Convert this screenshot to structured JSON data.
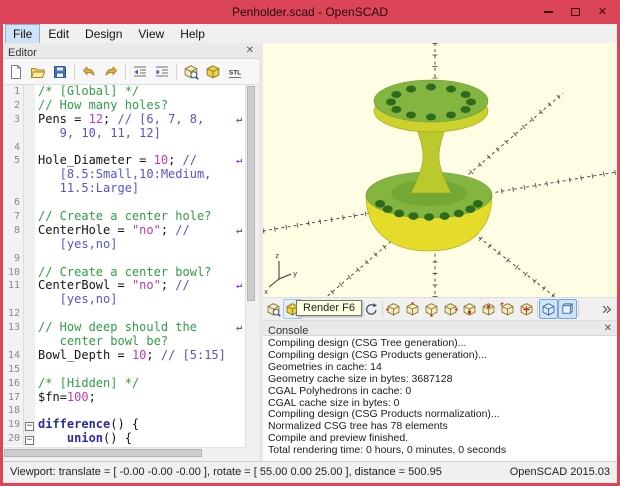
{
  "window": {
    "title": "Penholder.scad - OpenSCAD",
    "controls": [
      "minimize",
      "maximize",
      "close"
    ]
  },
  "menu": {
    "items": [
      {
        "label": "File",
        "highlighted": true
      },
      {
        "label": "Edit"
      },
      {
        "label": "Design"
      },
      {
        "label": "View"
      },
      {
        "label": "Help"
      }
    ]
  },
  "editor": {
    "title": "Editor",
    "close": "✕",
    "toolbar_groups": [
      [
        "new-file-icon",
        "open-folder-icon",
        "save-icon"
      ],
      [
        "undo-icon",
        "redo-icon"
      ],
      [
        "unindent-icon",
        "indent-icon"
      ],
      [
        "preview-icon",
        "render-icon",
        "export-stl-icon"
      ]
    ],
    "rows": [
      {
        "n": "1",
        "s": [
          [
            "/* [Global] */",
            "cm"
          ]
        ]
      },
      {
        "n": "2",
        "s": [
          [
            "// How many holes?",
            "cm"
          ]
        ]
      },
      {
        "n": "3",
        "m": true,
        "s": [
          [
            "Pens",
            "id"
          ],
          [
            " = ",
            "pl"
          ],
          [
            "12",
            "nu"
          ],
          [
            "; ",
            "pl"
          ],
          [
            "// [6, 7, 8,",
            "cb"
          ]
        ]
      },
      {
        "n": "",
        "s": [
          [
            "   9, 10, 11, 12]",
            "cb"
          ]
        ]
      },
      {
        "n": "4",
        "s": []
      },
      {
        "n": "5",
        "m": true,
        "s": [
          [
            "Hole_Diameter",
            "id"
          ],
          [
            " = ",
            "pl"
          ],
          [
            "10",
            "nu"
          ],
          [
            "; ",
            "pl"
          ],
          [
            "//",
            "cb"
          ]
        ]
      },
      {
        "n": "",
        "s": [
          [
            "   [8.5:Small,10:Medium,",
            "cb"
          ]
        ]
      },
      {
        "n": "",
        "s": [
          [
            "   11.5:Large]",
            "cb"
          ]
        ]
      },
      {
        "n": "6",
        "s": []
      },
      {
        "n": "7",
        "s": [
          [
            "// Create a center hole?",
            "cm"
          ]
        ]
      },
      {
        "n": "8",
        "m": true,
        "s": [
          [
            "CenterHole",
            "id"
          ],
          [
            " = ",
            "pl"
          ],
          [
            "\"no\"",
            "st"
          ],
          [
            "; ",
            "pl"
          ],
          [
            "//",
            "cb"
          ]
        ]
      },
      {
        "n": "",
        "s": [
          [
            "   [yes,no]",
            "cb"
          ]
        ]
      },
      {
        "n": "9",
        "s": []
      },
      {
        "n": "10",
        "s": [
          [
            "// Create a center bowl?",
            "cm"
          ]
        ]
      },
      {
        "n": "11",
        "m": true,
        "s": [
          [
            "CenterBowl",
            "id"
          ],
          [
            " = ",
            "pl"
          ],
          [
            "\"no\"",
            "st"
          ],
          [
            "; ",
            "pl"
          ],
          [
            "//",
            "cb"
          ]
        ]
      },
      {
        "n": "",
        "s": [
          [
            "   [yes,no]",
            "cb"
          ]
        ]
      },
      {
        "n": "12",
        "s": []
      },
      {
        "n": "13",
        "m": true,
        "s": [
          [
            "// How deep should the",
            "cm"
          ]
        ]
      },
      {
        "n": "",
        "s": [
          [
            "   center bowl be?",
            "cm"
          ]
        ]
      },
      {
        "n": "14",
        "s": [
          [
            "Bowl_Depth",
            "id"
          ],
          [
            " = ",
            "pl"
          ],
          [
            "10",
            "nu"
          ],
          [
            "; ",
            "pl"
          ],
          [
            "// [5:15]",
            "cb"
          ]
        ]
      },
      {
        "n": "15",
        "s": []
      },
      {
        "n": "16",
        "s": [
          [
            "/* [Hidden] */",
            "cm"
          ]
        ]
      },
      {
        "n": "17",
        "s": [
          [
            "$fn",
            "id"
          ],
          [
            "=",
            "pl"
          ],
          [
            "100",
            "nu"
          ],
          [
            ";",
            "pl"
          ]
        ]
      },
      {
        "n": "18",
        "s": []
      },
      {
        "n": "19",
        "f": true,
        "s": [
          [
            "difference",
            "kw"
          ],
          [
            "() {",
            "pl"
          ]
        ]
      },
      {
        "n": "20",
        "f": true,
        "s": [
          [
            "    ",
            "pl"
          ],
          [
            "union",
            "kw"
          ],
          [
            "() {",
            "pl"
          ]
        ]
      }
    ]
  },
  "viewport": {
    "tooltip": "Render F6",
    "toolbar_groups": [
      [
        {
          "icon": "preview-icon"
        },
        {
          "icon": "render-icon",
          "hover": true
        }
      ],
      [
        "zoom-all-icon",
        "zoom-in-icon",
        "zoom-out-icon",
        "reset-view-icon"
      ],
      [
        "view-right-icon",
        "view-top-icon",
        "view-bottom-icon",
        "view-left-icon",
        "view-front-icon",
        "view-back-icon",
        "view-diagonal-icon",
        "view-center-icon"
      ],
      [
        {
          "icon": "perspective-icon",
          "checked": true
        },
        {
          "icon": "orthogonal-icon",
          "checked": true
        }
      ],
      [
        {
          "icon": "overflow-icon",
          "last": true
        }
      ]
    ]
  },
  "console": {
    "title": "Console",
    "close": "✕",
    "lines": [
      "Compiling design (CSG Tree generation)...",
      "Compiling design (CSG Products generation)...",
      "Geometries in cache: 14",
      "Geometry cache size in bytes: 3687128",
      "CGAL Polyhedrons in cache: 0",
      "CGAL cache size in bytes: 0",
      "Compiling design (CSG Products normalization)...",
      "Normalized CSG tree has 78 elements",
      "Compile and preview finished.",
      "Total rendering time: 0 hours, 0 minutes, 0 seconds"
    ]
  },
  "statusbar": {
    "left": "Viewport: translate = [ -0.00 -0.00 -0.00 ], rotate = [ 55.00 0.00 25.00 ], distance = 500.95",
    "right": "OpenSCAD 2015.03"
  },
  "colors": {
    "chrome": "#dc4557",
    "vpbg": "#fffee5",
    "green": "#83b540",
    "green_dark": "#74a835",
    "yellow": "#ccd12b",
    "yellow_bright": "#e4dc28",
    "neck": "#bcc92c",
    "hole": "#2e6b1d",
    "cm": "#2f9e44",
    "cb": "#5552d6",
    "nu": "#c339b4",
    "st": "#b5399d",
    "kw": "#2b2ba6"
  }
}
